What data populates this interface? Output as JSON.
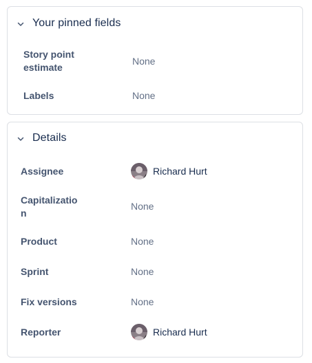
{
  "pinned": {
    "title": "Your pinned fields",
    "fields": [
      {
        "label": "Story point\nestimate",
        "value": "None"
      },
      {
        "label": "Labels",
        "value": "None"
      }
    ]
  },
  "details": {
    "title": "Details",
    "fields": [
      {
        "label": "Assignee",
        "value": "Richard Hurt",
        "type": "person"
      },
      {
        "label": "Capitalizatio\nn",
        "value": "None"
      },
      {
        "label": "Product",
        "value": "None"
      },
      {
        "label": "Sprint",
        "value": "None"
      },
      {
        "label": "Fix versions",
        "value": "None"
      },
      {
        "label": "Reporter",
        "value": "Richard Hurt",
        "type": "person"
      }
    ]
  },
  "icons": {
    "collapse": "chevron-down-icon",
    "avatar": "user-avatar"
  },
  "colors": {
    "border": "#dcdfe4",
    "label": "#44546f",
    "value_empty": "#626f86",
    "text": "#172b4d"
  }
}
